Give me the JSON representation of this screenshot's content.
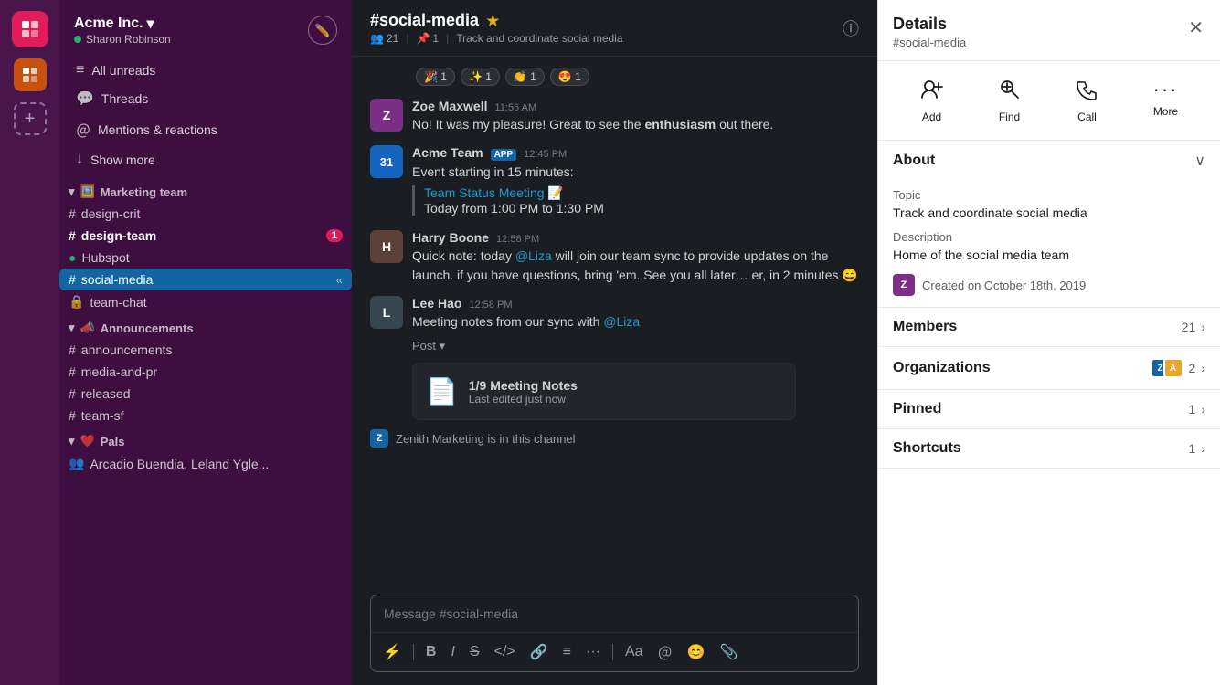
{
  "workspace": {
    "name": "Acme Inc.",
    "chevron": "▾",
    "user": "Sharon Robinson",
    "online_status": "online"
  },
  "sidebar": {
    "nav_items": [
      {
        "id": "all-unreads",
        "icon": "≡",
        "label": "All unreads"
      },
      {
        "id": "threads",
        "icon": "💬",
        "label": "Threads"
      },
      {
        "id": "mentions",
        "icon": "＠",
        "label": "Mentions & reactions"
      },
      {
        "id": "show-more",
        "icon": "↓",
        "label": "Show more"
      }
    ],
    "sections": [
      {
        "id": "marketing",
        "label": "Marketing team",
        "emoji": "🖼️",
        "channels": [
          {
            "id": "design-crit",
            "name": "design-crit",
            "type": "hash",
            "badge": null,
            "active": false,
            "bold": false
          },
          {
            "id": "design-team",
            "name": "design-team",
            "type": "hash",
            "badge": "1",
            "active": false,
            "bold": true
          },
          {
            "id": "hubspot",
            "name": "Hubspot",
            "type": "dot",
            "badge": null,
            "active": false,
            "bold": false
          },
          {
            "id": "social-media",
            "name": "social-media",
            "type": "hash",
            "badge": null,
            "active": true,
            "bold": false
          },
          {
            "id": "team-chat",
            "name": "team-chat",
            "type": "lock",
            "badge": null,
            "active": false,
            "bold": false
          }
        ]
      },
      {
        "id": "announcements",
        "label": "Announcements",
        "emoji": "📣",
        "channels": [
          {
            "id": "announcements",
            "name": "announcements",
            "type": "hash",
            "badge": null,
            "active": false,
            "bold": false
          },
          {
            "id": "media-and-pr",
            "name": "media-and-pr",
            "type": "hash",
            "badge": null,
            "active": false,
            "bold": false
          },
          {
            "id": "released",
            "name": "released",
            "type": "hash",
            "badge": null,
            "active": false,
            "bold": false
          },
          {
            "id": "team-sf",
            "name": "team-sf",
            "type": "hash",
            "badge": null,
            "active": false,
            "bold": false
          }
        ]
      },
      {
        "id": "pals",
        "label": "Pals",
        "emoji": "❤️",
        "channels": [
          {
            "id": "arcadio",
            "name": "Arcadio Buendia, Leland Ygle...",
            "type": "people",
            "badge": null,
            "active": false,
            "bold": false
          }
        ]
      }
    ]
  },
  "chat": {
    "channel_name": "#social-media",
    "channel_star": "★",
    "members_count": "21",
    "pins_count": "1",
    "topic": "Track and coordinate social media",
    "reactions": [
      {
        "emoji": "🎉",
        "count": "1"
      },
      {
        "emoji": "✨",
        "count": "1"
      },
      {
        "emoji": "👏",
        "count": "1"
      },
      {
        "emoji": "😍",
        "count": "1"
      }
    ],
    "messages": [
      {
        "id": "msg1",
        "sender": "Zoe Maxwell",
        "time": "11:56 AM",
        "avatar_initials": "Z",
        "avatar_color": "#7c3085",
        "text": "No! It was my pleasure! Great to see the enthusiasm out there.",
        "bold_words": [
          "enthusiasm"
        ]
      },
      {
        "id": "msg2",
        "sender": "Acme Team",
        "app_badge": "APP",
        "time": "12:45 PM",
        "avatar_text": "31",
        "avatar_color": "#1565c0",
        "text": "Event starting in 15 minutes:",
        "quote_link": "Team Status Meeting 📝",
        "quote_text": "Today from 1:00 PM to 1:30 PM"
      },
      {
        "id": "msg3",
        "sender": "Harry Boone",
        "time": "12:58 PM",
        "avatar_initials": "H",
        "avatar_color": "#5d4037",
        "text": "Quick note: today @Liza will join our team sync to provide updates on the launch. if you have questions, bring 'em. See you all later… er, in 2 minutes 😄",
        "bold_words": [
          "@Liza"
        ]
      },
      {
        "id": "msg4",
        "sender": "Lee Hao",
        "time": "12:58 PM",
        "avatar_initials": "L",
        "avatar_color": "#37474f",
        "text": "Meeting notes from our sync with @Liza",
        "post_label": "Post ▾",
        "doc_title": "1/9 Meeting Notes",
        "doc_meta": "Last edited just now"
      }
    ],
    "channel_notification": "Zenith Marketing is in this channel",
    "input_placeholder": "Message #social-media",
    "toolbar_items": [
      "⚡",
      "B",
      "I",
      "S̶",
      "</>",
      "🔗",
      "≡",
      "···",
      "Aa",
      "＠",
      "😊",
      "📎"
    ]
  },
  "details": {
    "title": "Details",
    "subtitle": "#social-media",
    "close": "✕",
    "actions": [
      {
        "id": "add",
        "icon": "👤+",
        "label": "Add"
      },
      {
        "id": "find",
        "icon": "🔍",
        "label": "Find"
      },
      {
        "id": "call",
        "icon": "📞",
        "label": "Call"
      },
      {
        "id": "more",
        "icon": "···",
        "label": "More"
      }
    ],
    "about": {
      "section_title": "About",
      "topic_label": "Topic",
      "topic_value": "Track and coordinate social media",
      "description_label": "Description",
      "description_value": "Home of the social media team",
      "created_text": "Created on October 18th, 2019"
    },
    "members": {
      "label": "Members",
      "count": "21"
    },
    "organizations": {
      "label": "Organizations",
      "count": "2"
    },
    "pinned": {
      "label": "Pinned",
      "count": "1"
    },
    "shortcuts": {
      "label": "Shortcuts",
      "count": "1"
    }
  }
}
